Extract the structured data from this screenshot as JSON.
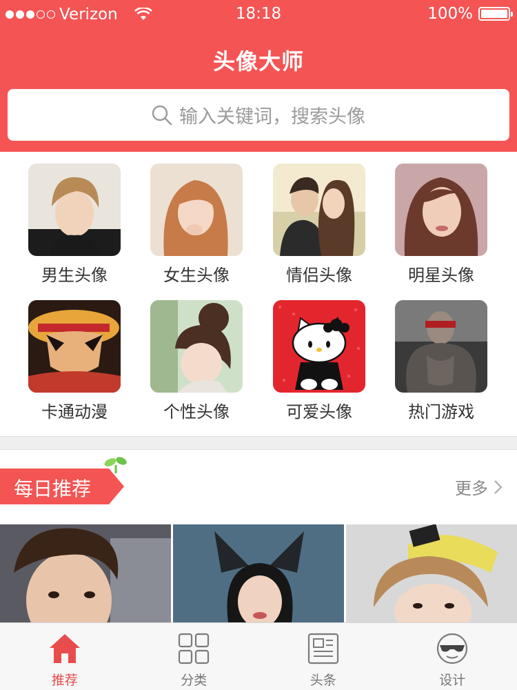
{
  "status_bar": {
    "carrier": "Verizon",
    "time": "18:18",
    "battery": "100%"
  },
  "header": {
    "title": "头像大师"
  },
  "search": {
    "placeholder": "输入关键词，搜索头像"
  },
  "categories": [
    {
      "label": "男生头像",
      "icon": "male-avatar-photo"
    },
    {
      "label": "女生头像",
      "icon": "female-avatar-photo"
    },
    {
      "label": "情侣头像",
      "icon": "couple-avatar-photo"
    },
    {
      "label": "明星头像",
      "icon": "celebrity-avatar-photo"
    },
    {
      "label": "卡通动漫",
      "icon": "cartoon-anime-photo"
    },
    {
      "label": "个性头像",
      "icon": "personality-avatar-photo"
    },
    {
      "label": "可爱头像",
      "icon": "hello-kitty-photo"
    },
    {
      "label": "热门游戏",
      "icon": "game-character-photo"
    }
  ],
  "daily": {
    "title": "每日推荐",
    "more": "更多"
  },
  "tabs": [
    {
      "label": "推荐",
      "icon": "home-icon",
      "active": true
    },
    {
      "label": "分类",
      "icon": "grid-icon",
      "active": false
    },
    {
      "label": "头条",
      "icon": "news-icon",
      "active": false
    },
    {
      "label": "设计",
      "icon": "sunglasses-face-icon",
      "active": false
    }
  ],
  "colors": {
    "brand": "#f45454",
    "tab_active": "#e84c4c"
  }
}
